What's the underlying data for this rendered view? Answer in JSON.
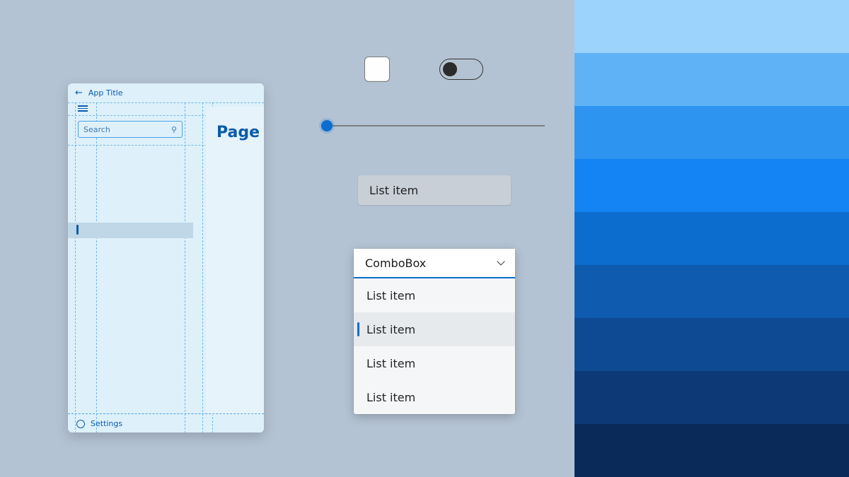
{
  "app": {
    "title": "App Title",
    "page_title": "Page T",
    "search_placeholder": "Search",
    "settings_label": "Settings"
  },
  "controls": {
    "checkbox_checked": false,
    "toggle_on": false,
    "slider_value": 0,
    "list_item_label": "List item",
    "combobox": {
      "label": "ComboBox",
      "items": [
        "List item",
        "List item",
        "List item",
        "List item"
      ],
      "selected_index": 1
    }
  },
  "palette": [
    "#9bd3fc",
    "#5fb2f5",
    "#2d94ef",
    "#1483f3",
    "#0c6dcf",
    "#0e5bb0",
    "#0e4a93",
    "#0d3a76",
    "#0a2a5a"
  ]
}
